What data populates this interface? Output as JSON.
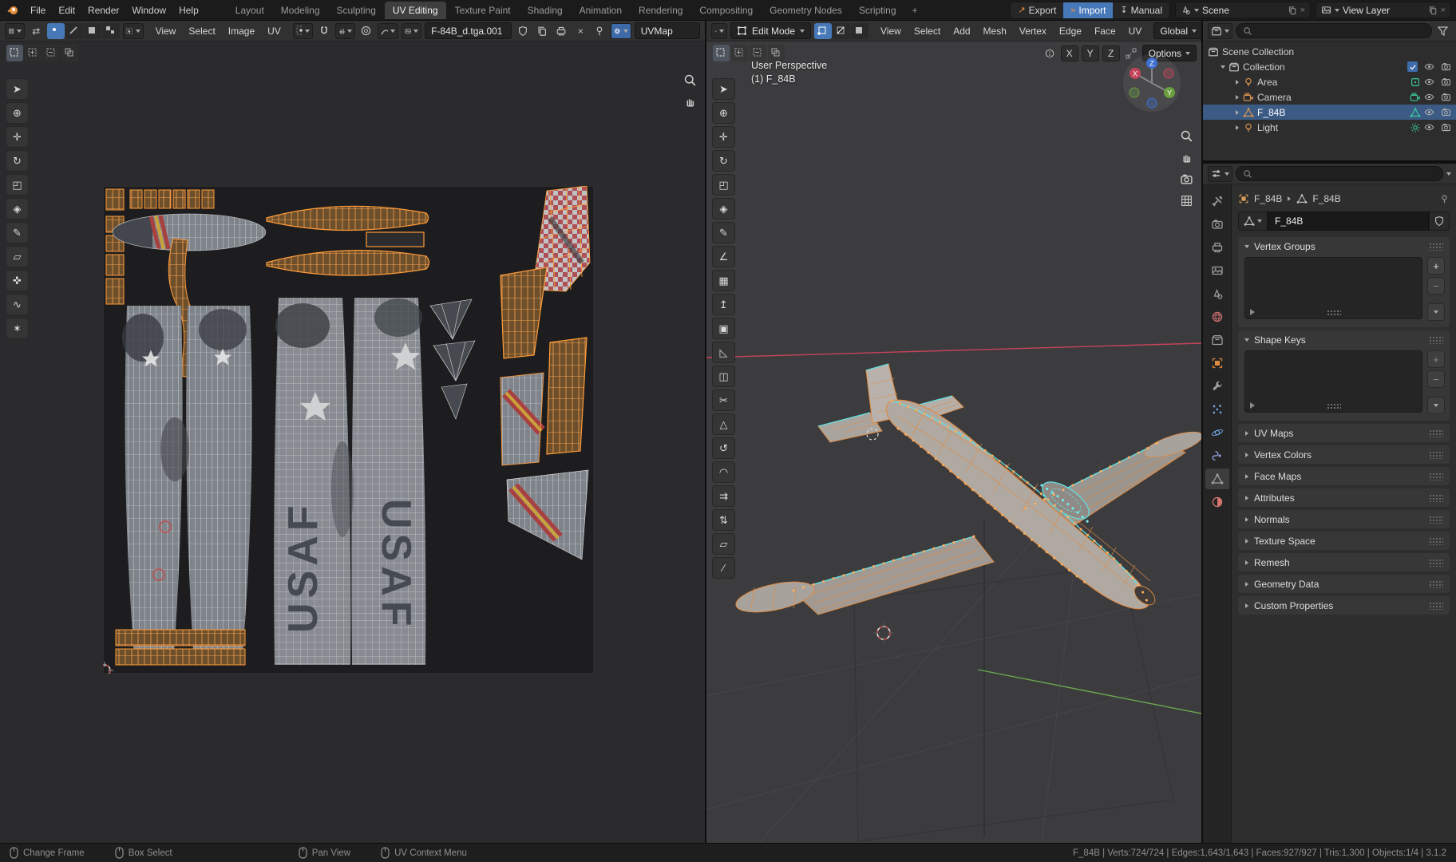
{
  "topbar": {
    "menus": [
      {
        "label": "File"
      },
      {
        "label": "Edit"
      },
      {
        "label": "Render"
      },
      {
        "label": "Window"
      },
      {
        "label": "Help"
      }
    ],
    "workspaces": [
      {
        "label": "Layout"
      },
      {
        "label": "Modeling"
      },
      {
        "label": "Sculpting"
      },
      {
        "label": "UV Editing",
        "active": true
      },
      {
        "label": "Texture Paint"
      },
      {
        "label": "Shading"
      },
      {
        "label": "Animation"
      },
      {
        "label": "Rendering"
      },
      {
        "label": "Compositing"
      },
      {
        "label": "Geometry Nodes"
      },
      {
        "label": "Scripting"
      }
    ],
    "add_workspace": "+",
    "export_label": "Export",
    "import_label": "Import",
    "manual_label": "Manual",
    "scene_name": "Scene",
    "view_layer_name": "View Layer",
    "close_glyph": "×"
  },
  "uv_editor": {
    "menus": [
      {
        "label": "View"
      },
      {
        "label": "Select"
      },
      {
        "label": "Image"
      },
      {
        "label": "UV"
      }
    ],
    "sync_glyph": "⇄",
    "image_name": "F-84B_d.tga.001",
    "uvmap_name": "UVMap",
    "close_glyph": "×",
    "texture_marking": "USAF",
    "tools": [
      {
        "g": "➤",
        "name": "tool-select-box"
      },
      {
        "g": "⊕",
        "name": "tool-2d-cursor"
      },
      {
        "g": "✛",
        "name": "tool-move"
      },
      {
        "g": "↻",
        "name": "tool-rotate"
      },
      {
        "g": "◰",
        "name": "tool-scale"
      },
      {
        "g": "◈",
        "name": "tool-transform"
      },
      {
        "g": "✎",
        "name": "tool-annotate"
      },
      {
        "g": "▱",
        "name": "tool-rip-region"
      },
      {
        "g": "✜",
        "name": "tool-grab"
      },
      {
        "g": "∿",
        "name": "tool-relax"
      },
      {
        "g": "✶",
        "name": "tool-pinch"
      }
    ]
  },
  "viewport": {
    "mode_label": "Edit Mode",
    "menus": [
      {
        "label": "View"
      },
      {
        "label": "Select"
      },
      {
        "label": "Add"
      },
      {
        "label": "Mesh"
      },
      {
        "label": "Vertex"
      },
      {
        "label": "Edge"
      },
      {
        "label": "Face"
      },
      {
        "label": "UV"
      }
    ],
    "orientation": "Global",
    "options_label": "Options",
    "mirror_axes": [
      {
        "label": "X"
      },
      {
        "label": "Y"
      },
      {
        "label": "Z"
      }
    ],
    "overlay_line1": "User Perspective",
    "overlay_line2": "(1) F_84B",
    "tools": [
      {
        "g": "➤",
        "name": "tool-select-box"
      },
      {
        "g": "⊕",
        "name": "tool-cursor"
      },
      {
        "g": "✛",
        "name": "tool-move"
      },
      {
        "g": "↻",
        "name": "tool-rotate"
      },
      {
        "g": "◰",
        "name": "tool-scale"
      },
      {
        "g": "◈",
        "name": "tool-transform"
      },
      {
        "g": "✎",
        "name": "tool-annotate"
      },
      {
        "g": "∠",
        "name": "tool-measure"
      },
      {
        "g": "▦",
        "name": "tool-add-cube"
      },
      {
        "g": "↥",
        "name": "tool-extrude"
      },
      {
        "g": "▣",
        "name": "tool-inset-faces"
      },
      {
        "g": "◺",
        "name": "tool-bevel"
      },
      {
        "g": "◫",
        "name": "tool-loop-cut"
      },
      {
        "g": "✂",
        "name": "tool-knife"
      },
      {
        "g": "△",
        "name": "tool-poly-build"
      },
      {
        "g": "↺",
        "name": "tool-spin"
      },
      {
        "g": "◠",
        "name": "tool-smooth"
      },
      {
        "g": "⇉",
        "name": "tool-edge-slide"
      },
      {
        "g": "⇅",
        "name": "tool-shrink-fatten"
      },
      {
        "g": "▱",
        "name": "tool-shear"
      },
      {
        "g": "∕",
        "name": "tool-rip-region"
      }
    ]
  },
  "outliner": {
    "scene_collection": "Scene Collection",
    "collection": "Collection",
    "items": [
      {
        "name": "Area",
        "icon": "bulb",
        "dicon": "arealight"
      },
      {
        "name": "Camera",
        "icon": "cam",
        "dicon": "cam"
      },
      {
        "name": "F_84B",
        "icon": "mesh",
        "dicon": "mesh",
        "selected": true
      },
      {
        "name": "Light",
        "icon": "bulb",
        "dicon": "sun"
      }
    ]
  },
  "properties": {
    "breadcrumb_object": "F_84B",
    "breadcrumb_data": "F_84B",
    "name_value": "F_84B",
    "tabs": [
      {
        "icon": "tool"
      },
      {
        "icon": "cam2"
      },
      {
        "icon": "printer"
      },
      {
        "icon": "photos"
      },
      {
        "icon": "scenecone"
      },
      {
        "icon": "world"
      },
      {
        "icon": "boxc"
      },
      {
        "icon": "object"
      },
      {
        "icon": "wrench"
      },
      {
        "icon": "particles"
      },
      {
        "icon": "physics"
      },
      {
        "icon": "constraint"
      },
      {
        "icon": "meshtab",
        "active": true
      },
      {
        "icon": "material"
      }
    ],
    "open_panels": [
      {
        "title": "Vertex Groups"
      },
      {
        "title": "Shape Keys"
      }
    ],
    "collapsed_panels": [
      {
        "title": "UV Maps"
      },
      {
        "title": "Vertex Colors"
      },
      {
        "title": "Face Maps"
      },
      {
        "title": "Attributes"
      },
      {
        "title": "Normals"
      },
      {
        "title": "Texture Space"
      },
      {
        "title": "Remesh"
      },
      {
        "title": "Geometry Data"
      },
      {
        "title": "Custom Properties"
      }
    ],
    "plus_glyph": "+",
    "minus_glyph": "−"
  },
  "statusbar": {
    "hints": [
      {
        "label": "Change Frame",
        "btn": "left"
      },
      {
        "label": "Box Select",
        "btn": "drag"
      },
      {
        "label": "Pan View",
        "btn": "mid"
      },
      {
        "label": "UV Context Menu",
        "btn": "right"
      }
    ],
    "stats": "F_84B | Verts:724/724 | Edges:1,643/1,643 | Faces:927/927 | Tris:1,300 | Objects:1/4 | 3.1.2"
  },
  "colors": {
    "accent_blue": "#4778b8",
    "accent_orange": "#e8913f",
    "data_green": "#3ecf8e",
    "axis_red": "#c5445a",
    "axis_green": "#6aa84f",
    "selection_blue": "#3b5b85"
  }
}
